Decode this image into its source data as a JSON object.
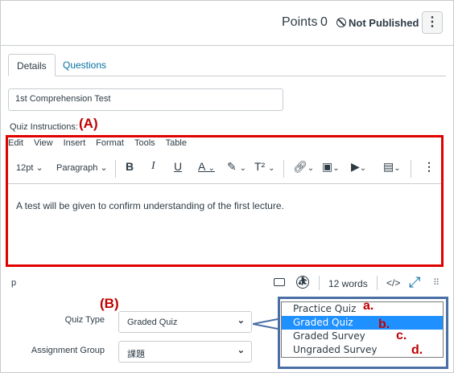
{
  "header": {
    "points_label": "Points",
    "points_value": "0",
    "publish_status": "Not Published",
    "menu_icon": "more-vertical-icon"
  },
  "tabs": [
    {
      "label": "Details",
      "active": true
    },
    {
      "label": "Questions",
      "active": false
    }
  ],
  "quiz_title": {
    "value": "1st Comprehension Test"
  },
  "instructions": {
    "label": "Quiz Instructions:",
    "annotation": "(A)",
    "menubar": [
      "Edit",
      "View",
      "Insert",
      "Format",
      "Tools",
      "Table"
    ],
    "toolbar": {
      "font_size": "12pt",
      "block_format": "Paragraph",
      "bold": "B",
      "italic": "I",
      "underline": "U",
      "text_color": "A",
      "superscript": "T²"
    },
    "body": "A test will be given to confirm understanding of the first lecture.",
    "statusbar": {
      "path": "p",
      "word_count": "12 words",
      "html_toggle": "</>"
    }
  },
  "quiz_type": {
    "annotation": "(B)",
    "label": "Quiz Type",
    "selected": "Graded Quiz",
    "options": [
      {
        "label": "Practice Quiz",
        "marker": "a."
      },
      {
        "label": "Graded Quiz",
        "marker": "b."
      },
      {
        "label": "Graded Survey",
        "marker": "c."
      },
      {
        "label": "Ungraded Survey",
        "marker": "d."
      }
    ]
  },
  "assignment_group": {
    "label": "Assignment Group",
    "selected": "課題"
  },
  "colors": {
    "annotation_red": "#c00000",
    "link_blue": "#0770a3",
    "highlight_blue": "#1e90ff",
    "callout_blue": "#4a6fa5"
  }
}
